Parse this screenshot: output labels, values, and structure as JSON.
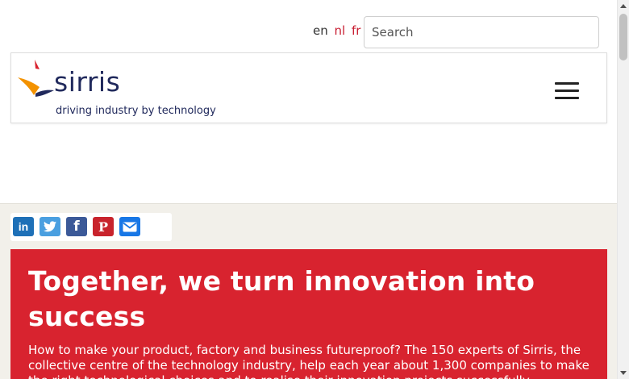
{
  "languages": [
    {
      "code": "en",
      "active": true
    },
    {
      "code": "nl",
      "active": false
    },
    {
      "code": "fr",
      "active": false
    }
  ],
  "search": {
    "placeholder": "Search"
  },
  "brand": {
    "name": "sirris",
    "tagline": "driving industry by technology",
    "color_navy": "#20295c",
    "color_red": "#d8232f",
    "color_orange": "#f39200"
  },
  "menu": {
    "icon": "hamburger-menu-icon"
  },
  "share": [
    {
      "network": "linkedin",
      "icon": "linkedin-icon",
      "glyph": "in",
      "color": "#1e70b7"
    },
    {
      "network": "twitter",
      "icon": "twitter-icon",
      "glyph": "",
      "color": "#4a9fe0"
    },
    {
      "network": "facebook",
      "icon": "facebook-icon",
      "glyph": "f",
      "color": "#3b5998"
    },
    {
      "network": "pinterest",
      "icon": "pinterest-icon",
      "glyph": "P",
      "color": "#c8232c"
    },
    {
      "network": "email",
      "icon": "email-icon",
      "glyph": "",
      "color": "#1877e6"
    }
  ],
  "hero": {
    "title": "Together, we turn innovation into success",
    "body": "How to make your product, factory and business futureproof? The 150 experts of Sirris, the collective centre of the technology industry, help each year about 1,300 companies to make the right technological choices and to realise their innovation projects successfully."
  }
}
